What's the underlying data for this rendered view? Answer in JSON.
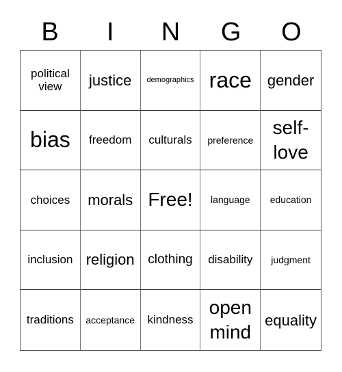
{
  "header": [
    "B",
    "I",
    "N",
    "G",
    "O"
  ],
  "cells": [
    {
      "text": "political view",
      "size": "s3"
    },
    {
      "text": "justice",
      "size": "s5"
    },
    {
      "text": "demographics",
      "size": "s1"
    },
    {
      "text": "race",
      "size": "s7"
    },
    {
      "text": "gender",
      "size": "s5"
    },
    {
      "text": "bias",
      "size": "s7"
    },
    {
      "text": "freedom",
      "size": "s3"
    },
    {
      "text": "culturals",
      "size": "s3"
    },
    {
      "text": "preference",
      "size": "s2"
    },
    {
      "text": "self-love",
      "size": "s6"
    },
    {
      "text": "choices",
      "size": "s3"
    },
    {
      "text": "morals",
      "size": "s5"
    },
    {
      "text": "Free!",
      "size": "s6"
    },
    {
      "text": "language",
      "size": "s2"
    },
    {
      "text": "education",
      "size": "s2"
    },
    {
      "text": "inclusion",
      "size": "s3"
    },
    {
      "text": "religion",
      "size": "s5"
    },
    {
      "text": "clothing",
      "size": "s4"
    },
    {
      "text": "disability",
      "size": "s3"
    },
    {
      "text": "judgment",
      "size": "s2"
    },
    {
      "text": "traditions",
      "size": "s3"
    },
    {
      "text": "acceptance",
      "size": "s2"
    },
    {
      "text": "kindness",
      "size": "s3"
    },
    {
      "text": "open mind",
      "size": "s6"
    },
    {
      "text": "equality",
      "size": "s5"
    }
  ]
}
